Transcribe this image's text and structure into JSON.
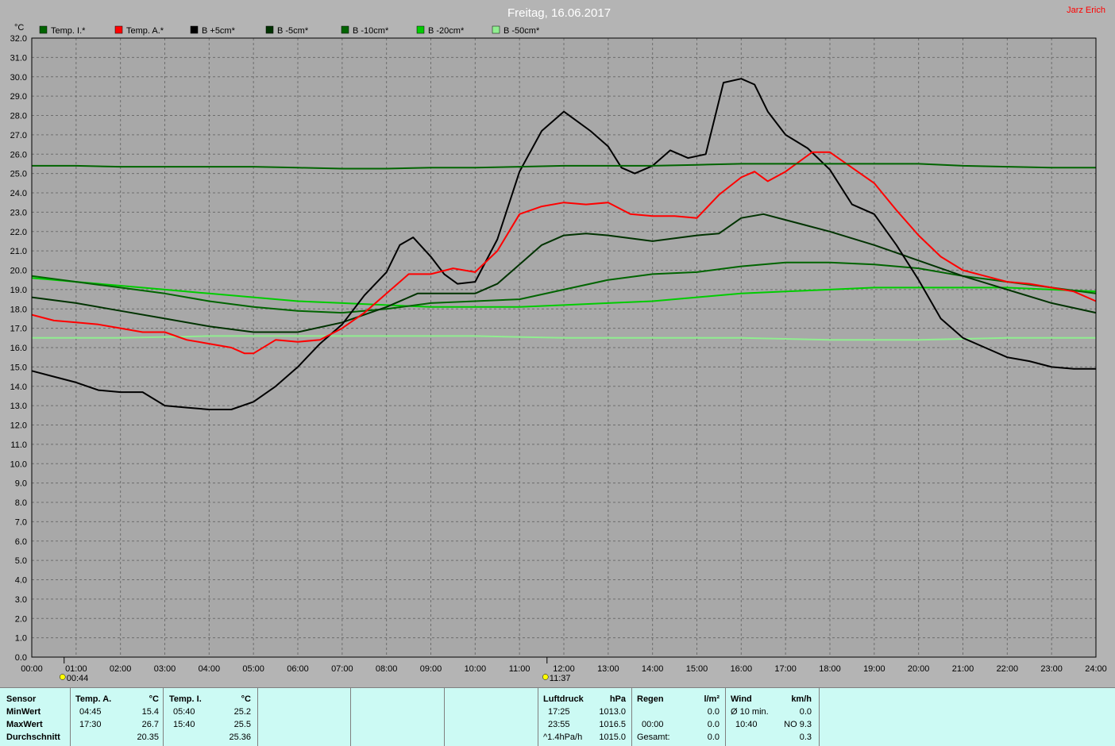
{
  "title": "Freitag, 16.06.2017",
  "author": "Jarz Erich",
  "unit_label": "°C",
  "colors": {
    "background": "#b4b4b4",
    "plot_bg": "#a8a8a8",
    "grid": "#6e6e6e",
    "axis_text": "#000000",
    "title_text": "#ffffff",
    "author_text": "#ff0000"
  },
  "chart_data": {
    "type": "line",
    "xlabel": "",
    "ylabel": "°C",
    "xlim": [
      0,
      24
    ],
    "ylim": [
      0,
      32
    ],
    "grid": true,
    "legend_position": "top",
    "x_ticks": [
      "00:00",
      "01:00",
      "02:00",
      "03:00",
      "04:00",
      "05:00",
      "06:00",
      "07:00",
      "08:00",
      "09:00",
      "10:00",
      "11:00",
      "12:00",
      "13:00",
      "14:00",
      "15:00",
      "16:00",
      "17:00",
      "18:00",
      "19:00",
      "20:00",
      "21:00",
      "22:00",
      "23:00",
      "24:00"
    ],
    "y_ticks": [
      "0.0",
      "1.0",
      "2.0",
      "3.0",
      "4.0",
      "5.0",
      "6.0",
      "7.0",
      "8.0",
      "9.0",
      "10.0",
      "11.0",
      "12.0",
      "13.0",
      "14.0",
      "15.0",
      "16.0",
      "17.0",
      "18.0",
      "19.0",
      "20.0",
      "21.0",
      "22.0",
      "23.0",
      "24.0",
      "25.0",
      "26.0",
      "27.0",
      "28.0",
      "29.0",
      "30.0",
      "31.0",
      "32.0"
    ],
    "markers": [
      {
        "label": "00:44",
        "x": 0.73,
        "icon": "sunrise-icon"
      },
      {
        "label": "11:37",
        "x": 11.62,
        "icon": "sun-icon"
      }
    ],
    "series": [
      {
        "name": "Temp. I.*",
        "color": "#006400",
        "x": [
          0,
          1,
          2,
          3,
          4,
          5,
          6,
          7,
          8,
          9,
          10,
          11,
          12,
          13,
          14,
          15,
          16,
          17,
          18,
          19,
          20,
          21,
          22,
          23,
          24
        ],
        "y": [
          25.4,
          25.4,
          25.35,
          25.35,
          25.35,
          25.35,
          25.3,
          25.25,
          25.25,
          25.3,
          25.3,
          25.35,
          25.4,
          25.4,
          25.4,
          25.45,
          25.5,
          25.5,
          25.5,
          25.5,
          25.5,
          25.4,
          25.35,
          25.3,
          25.3
        ]
      },
      {
        "name": "Temp. A.*",
        "color": "#ff0000",
        "x": [
          0,
          0.5,
          1,
          1.5,
          2,
          2.5,
          3,
          3.5,
          4,
          4.5,
          4.8,
          5,
          5.5,
          6,
          6.5,
          7,
          7.5,
          8,
          8.5,
          9,
          9.5,
          10,
          10.5,
          11,
          11.5,
          12,
          12.5,
          13,
          13.5,
          14,
          14.5,
          15,
          15.5,
          16,
          16.3,
          16.6,
          17,
          17.3,
          17.6,
          18,
          18.5,
          19,
          19.5,
          20,
          20.5,
          21,
          21.5,
          22,
          22.5,
          23,
          23.5,
          24
        ],
        "y": [
          17.7,
          17.4,
          17.3,
          17.2,
          17.0,
          16.8,
          16.8,
          16.4,
          16.2,
          16.0,
          15.7,
          15.7,
          16.4,
          16.3,
          16.4,
          17.0,
          17.8,
          18.8,
          19.8,
          19.8,
          20.1,
          19.9,
          21.0,
          22.9,
          23.3,
          23.5,
          23.4,
          23.5,
          22.9,
          22.8,
          22.8,
          22.7,
          23.9,
          24.8,
          25.1,
          24.6,
          25.1,
          25.6,
          26.1,
          26.1,
          25.3,
          24.5,
          23.1,
          21.8,
          20.7,
          20.0,
          19.7,
          19.4,
          19.3,
          19.1,
          18.9,
          18.4
        ]
      },
      {
        "name": "B +5cm*",
        "color": "#000000",
        "x": [
          0,
          0.5,
          1,
          1.5,
          2,
          2.5,
          3,
          3.5,
          4,
          4.5,
          5,
          5.5,
          6,
          6.5,
          7,
          7.5,
          8,
          8.3,
          8.6,
          9,
          9.3,
          9.6,
          10,
          10.5,
          11,
          11.5,
          12,
          12.3,
          12.6,
          13,
          13.3,
          13.6,
          14,
          14.4,
          14.8,
          15.2,
          15.6,
          16,
          16.3,
          16.6,
          17,
          17.5,
          18,
          18.5,
          19,
          19.5,
          20,
          20.5,
          21,
          21.5,
          22,
          22.5,
          23,
          23.5,
          24
        ],
        "y": [
          14.8,
          14.5,
          14.2,
          13.8,
          13.7,
          13.7,
          13.0,
          12.9,
          12.8,
          12.8,
          13.2,
          14.0,
          15.0,
          16.2,
          17.2,
          18.7,
          19.9,
          21.3,
          21.7,
          20.7,
          19.8,
          19.3,
          19.4,
          21.6,
          25.1,
          27.2,
          28.2,
          27.7,
          27.2,
          26.4,
          25.3,
          25.0,
          25.4,
          26.2,
          25.8,
          26.0,
          29.7,
          29.9,
          29.6,
          28.2,
          27.0,
          26.3,
          25.2,
          23.4,
          22.9,
          21.3,
          19.5,
          17.5,
          16.5,
          16.0,
          15.5,
          15.3,
          15.0,
          14.9,
          14.9
        ]
      },
      {
        "name": "B -5cm*",
        "color": "#003200",
        "x": [
          0,
          1,
          2,
          3,
          4,
          5,
          6,
          7,
          8,
          8.7,
          9,
          10,
          10.5,
          11,
          11.5,
          12,
          12.5,
          13,
          14,
          15,
          15.5,
          16,
          16.5,
          17,
          18,
          19,
          20,
          21,
          22,
          23,
          24
        ],
        "y": [
          18.6,
          18.3,
          17.9,
          17.5,
          17.1,
          16.8,
          16.8,
          17.3,
          18.1,
          18.8,
          18.8,
          18.8,
          19.3,
          20.3,
          21.3,
          21.8,
          21.9,
          21.8,
          21.5,
          21.8,
          21.9,
          22.7,
          22.9,
          22.6,
          22.0,
          21.3,
          20.5,
          19.7,
          19.0,
          18.3,
          17.8
        ]
      },
      {
        "name": "B -10cm*",
        "color": "#006400",
        "x": [
          0,
          1,
          2,
          3,
          4,
          5,
          6,
          7,
          8,
          9,
          10,
          11,
          12,
          13,
          14,
          15,
          16,
          17,
          18,
          19,
          20,
          21,
          22,
          23,
          24
        ],
        "y": [
          19.7,
          19.4,
          19.1,
          18.8,
          18.4,
          18.1,
          17.9,
          17.8,
          18.0,
          18.3,
          18.4,
          18.5,
          19.0,
          19.5,
          19.8,
          19.9,
          20.2,
          20.4,
          20.4,
          20.3,
          20.1,
          19.7,
          19.4,
          19.1,
          18.8
        ]
      },
      {
        "name": "B -20cm*",
        "color": "#00cc00",
        "x": [
          0,
          1,
          2,
          3,
          4,
          5,
          6,
          7,
          8,
          9,
          10,
          11,
          12,
          13,
          14,
          15,
          16,
          17,
          18,
          19,
          20,
          21,
          22,
          23,
          24
        ],
        "y": [
          19.6,
          19.4,
          19.2,
          19.0,
          18.8,
          18.6,
          18.4,
          18.3,
          18.2,
          18.1,
          18.1,
          18.1,
          18.2,
          18.3,
          18.4,
          18.6,
          18.8,
          18.9,
          19.0,
          19.1,
          19.1,
          19.1,
          19.1,
          19.0,
          18.9
        ]
      },
      {
        "name": "B -50cm*",
        "color": "#90ee90",
        "x": [
          0,
          2,
          4,
          6,
          8,
          10,
          12,
          14,
          16,
          18,
          20,
          22,
          24
        ],
        "y": [
          16.5,
          16.5,
          16.6,
          16.6,
          16.6,
          16.6,
          16.5,
          16.5,
          16.5,
          16.4,
          16.4,
          16.5,
          16.5
        ]
      }
    ]
  },
  "stats": {
    "row_labels": [
      "Sensor",
      "MinWert",
      "MaxWert",
      "Durchschnitt"
    ],
    "temp_a": {
      "header": "Temp. A.",
      "unit": "°C",
      "min_time": "04:45",
      "min_val": "15.4",
      "max_time": "17:30",
      "max_val": "26.7",
      "avg": "20.35"
    },
    "temp_i": {
      "header": "Temp. I.",
      "unit": "°C",
      "min_time": "05:40",
      "min_val": "25.2",
      "max_time": "15:40",
      "max_val": "25.5",
      "avg": "25.36"
    },
    "pressure": {
      "header": "Luftdruck",
      "unit": "hPa",
      "r1_time": "17:25",
      "r1_val": "1013.0",
      "r2_time": "23:55",
      "r2_val": "1016.5",
      "r3_label": "^1.4hPa/h",
      "r3_val": "1015.0"
    },
    "rain": {
      "header": "Regen",
      "unit": "l/m²",
      "r1_val": "0.0",
      "r2_time": "00:00",
      "r2_val": "0.0",
      "r3_label": "Gesamt:",
      "r3_val": "0.0"
    },
    "wind": {
      "header": "Wind",
      "unit": "km/h",
      "r1_label": "Ø 10 min.",
      "r1_val": "0.0",
      "r2_time": "10:40",
      "r2_val": "NO 9.3",
      "r3_val": "0.3"
    }
  }
}
